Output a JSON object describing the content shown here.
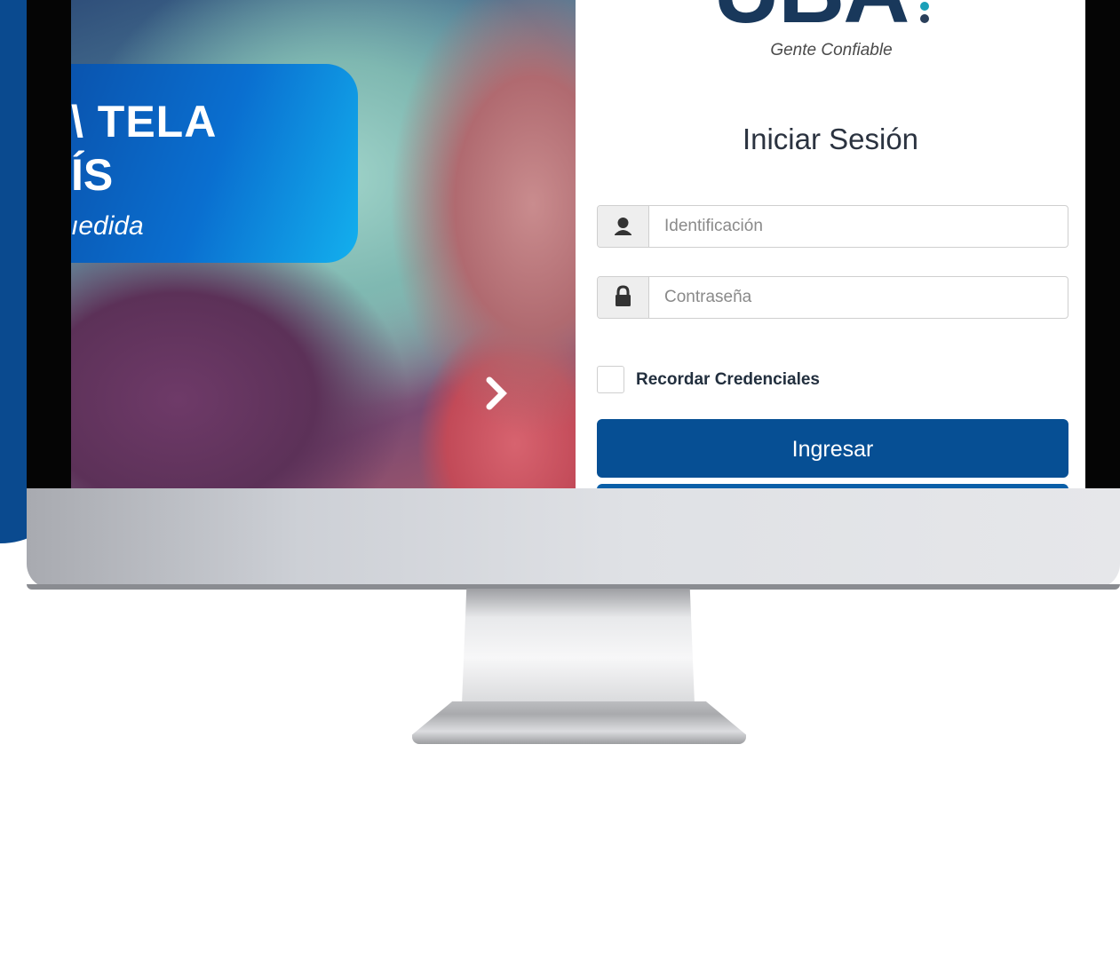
{
  "banner": {
    "line1": "\\ TELA",
    "line2": "ÍS",
    "line3": "ıedida"
  },
  "login": {
    "logo_text": "UBA",
    "tagline": "Gente Confiable",
    "title": "Iniciar Sesión",
    "id_placeholder": "Identificación",
    "password_placeholder": "Contraseña",
    "remember_label": "Recordar Credenciales",
    "submit_label": "Ingresar"
  },
  "colors": {
    "brand_blue": "#064f94",
    "logo_navy": "#19385b",
    "logo_dot_1": "#1aa0b8",
    "logo_dot_2": "#2a3f5a"
  },
  "icons": {
    "id_field": "user-icon",
    "password_field": "lock-icon",
    "carousel_next": "chevron-right-icon"
  }
}
